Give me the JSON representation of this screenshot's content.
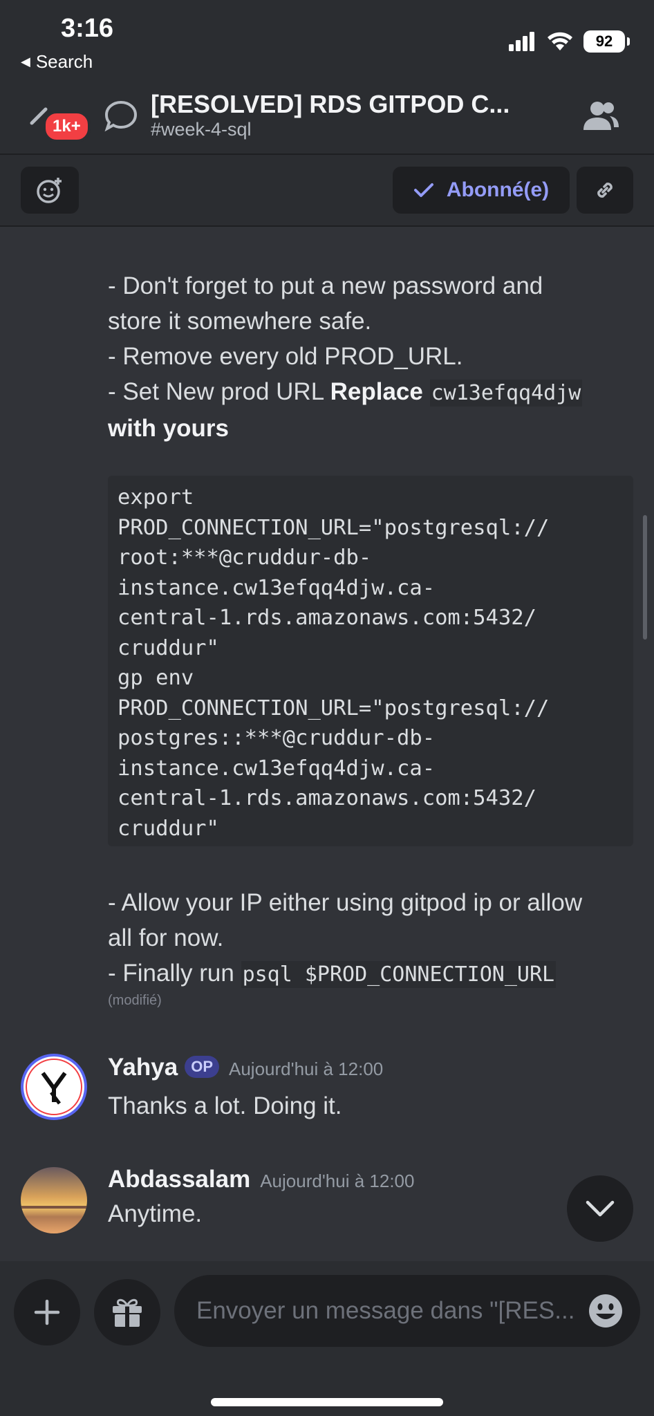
{
  "status_bar": {
    "time": "3:16",
    "back_label": "Search",
    "battery": "92"
  },
  "header": {
    "badge": "1k+",
    "title": "[RESOLVED] RDS GITPOD C...",
    "channel": "#week-4-sql"
  },
  "toolbar": {
    "follow_label": "Abonné(e)"
  },
  "message": {
    "line1": "- Don't forget to put a new password and",
    "line2": "store it somewhere safe.",
    "line3": "- Remove every old PROD_URL.",
    "line4_prefix": "- Set New prod URL ",
    "line4_bold": "Replace",
    "line4_code": "cw13efqq4djw",
    "line5_bold": "with yours",
    "code_block": "export\nPROD_CONNECTION_URL=\"postgresql://\nroot:***@cruddur-db-\ninstance.cw13efqq4djw.ca-\ncentral-1.rds.amazonaws.com:5432/\ncruddur\"\ngp env\nPROD_CONNECTION_URL=\"postgresql://\npostgres::***@cruddur-db-\ninstance.cw13efqq4djw.ca-\ncentral-1.rds.amazonaws.com:5432/\ncruddur\"",
    "line6": "- Allow your IP either using gitpod ip or allow",
    "line7": "all for now.",
    "line8_prefix": "- Finally run ",
    "line8_code": "psql $PROD_CONNECTION_URL",
    "edited": "(modifié)"
  },
  "replies": [
    {
      "author": "Yahya",
      "op_badge": "OP",
      "timestamp": "Aujourd'hui à 12:00",
      "text": "Thanks a lot. Doing it."
    },
    {
      "author": "Abdassalam",
      "timestamp": "Aujourd'hui à 12:00",
      "text": "Anytime."
    }
  ],
  "composer": {
    "placeholder": "Envoyer un message dans \"[RES..."
  },
  "colors": {
    "background": "#313338",
    "chrome": "#2b2d31",
    "accent": "#949cf7",
    "badge_red": "#f23f43"
  }
}
